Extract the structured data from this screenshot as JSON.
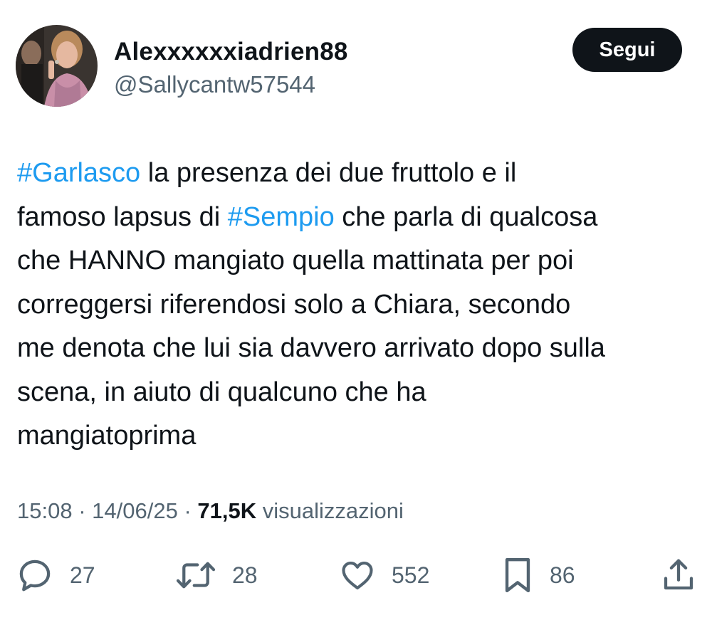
{
  "author": {
    "display_name": "Alexxxxxxiadrien88",
    "handle": "@Sallycantw57544",
    "avatar_icon": "profile-photo"
  },
  "follow_button": {
    "label": "Segui"
  },
  "tweet": {
    "segments": [
      {
        "type": "hashtag",
        "text": "#Garlasco"
      },
      {
        "type": "text",
        "text": " la presenza dei due fruttolo e il\nfamoso lapsus di "
      },
      {
        "type": "hashtag",
        "text": "#Sempio"
      },
      {
        "type": "text",
        "text": " che parla di qualcosa\nche HANNO mangiato quella mattinata per poi\ncorreggersi riferendosi solo a Chiara, secondo\nme denota che lui sia davvero arrivato dopo sulla\nscena, in aiuto di qualcuno che ha\nmangiatoprima"
      }
    ],
    "time": "15:08",
    "date": "14/06/25",
    "separator": "·",
    "views_count": "71,5K",
    "views_label": "visualizzazioni"
  },
  "actions": {
    "reply": {
      "icon": "reply-icon",
      "count": "27"
    },
    "retweet": {
      "icon": "retweet-icon",
      "count": "28"
    },
    "like": {
      "icon": "heart-icon",
      "count": "552"
    },
    "bookmark": {
      "icon": "bookmark-icon",
      "count": "86"
    },
    "share": {
      "icon": "share-icon"
    }
  },
  "colors": {
    "text": "#0f1419",
    "secondary": "#536471",
    "hashtag": "#1d9bf0",
    "follow_bg": "#0f1419"
  }
}
